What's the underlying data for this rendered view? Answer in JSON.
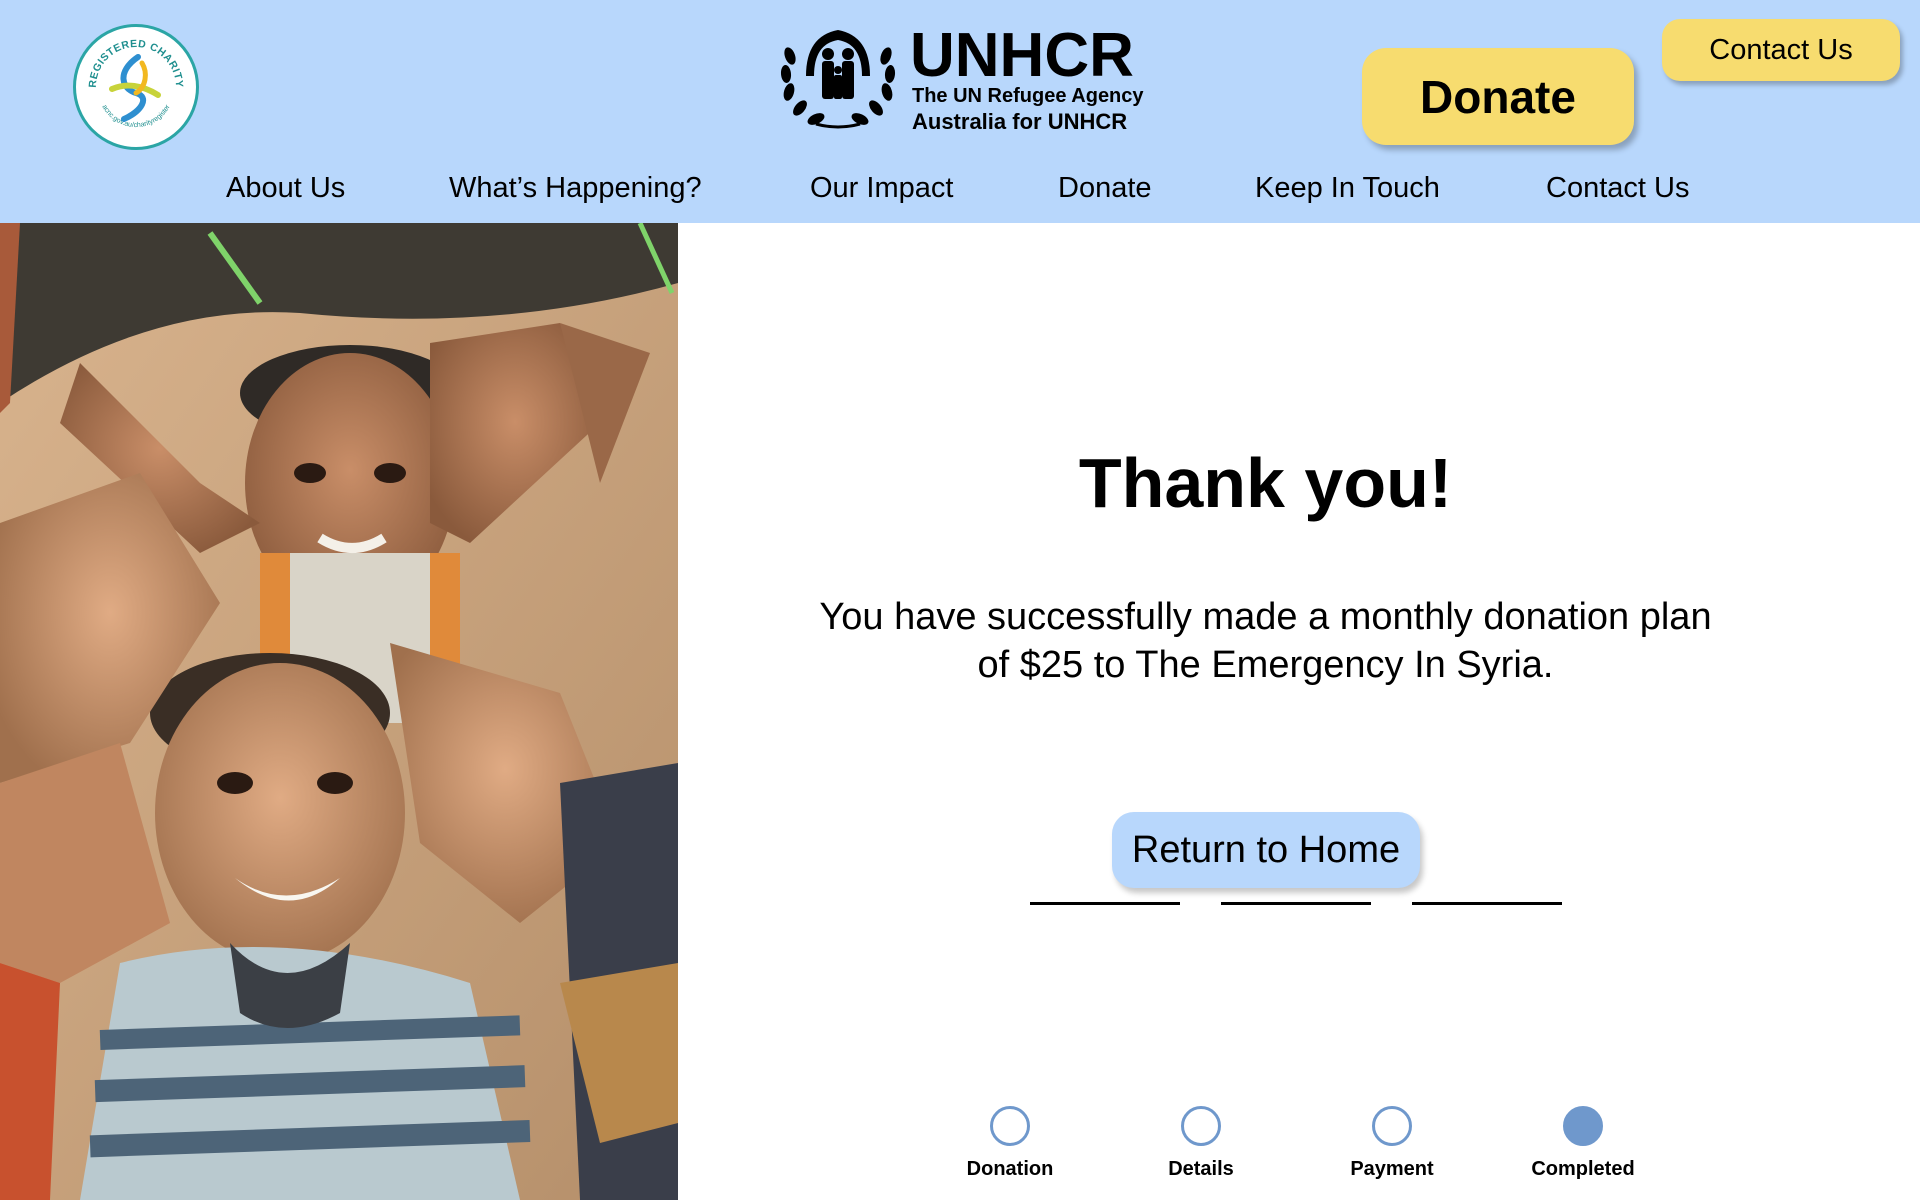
{
  "header": {
    "charity_badge": {
      "text_top": "REGISTERED CHARITY",
      "text_bottom": "acnc.gov.au/charityregister"
    },
    "logo": {
      "brand": "UNHCR",
      "tagline1": "The UN Refugee Agency",
      "tagline2": "Australia for UNHCR",
      "emblem_icon": "unhcr-emblem-icon"
    },
    "donate_label": "Donate",
    "contact_label": "Contact Us",
    "nav": [
      {
        "label": "About Us"
      },
      {
        "label": "What’s Happening?"
      },
      {
        "label": "Our Impact"
      },
      {
        "label": "Donate"
      },
      {
        "label": "Keep In Touch"
      },
      {
        "label": "Contact Us"
      }
    ]
  },
  "main": {
    "title": "Thank you!",
    "message_line1": "You have successfully made a monthly donation plan",
    "message_line2": "of $25 to The Emergency In Syria.",
    "return_label": "Return to Home"
  },
  "stepper": {
    "steps": [
      {
        "label": "Donation",
        "completed": false
      },
      {
        "label": "Details",
        "completed": false
      },
      {
        "label": "Payment",
        "completed": false
      },
      {
        "label": "Completed",
        "completed": true
      }
    ],
    "current_step": 4
  },
  "colors": {
    "header_bg": "#b8d7fc",
    "button_yellow": "#f7dc6f",
    "step_blue": "#6f98cc",
    "return_button": "#b8d7fc"
  }
}
